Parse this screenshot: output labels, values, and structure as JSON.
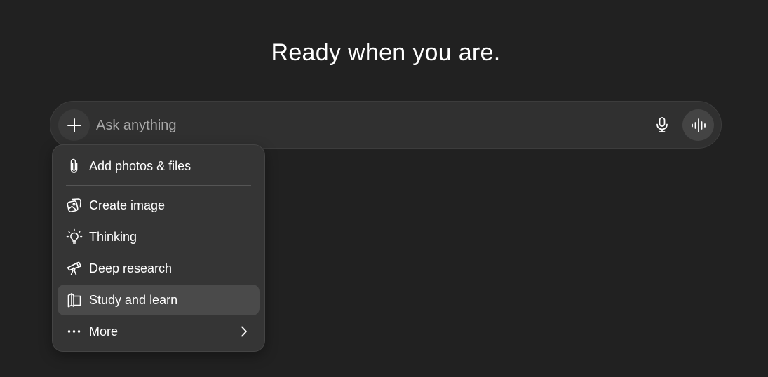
{
  "hero": {
    "title": "Ready when you are."
  },
  "composer": {
    "placeholder": "Ask anything",
    "value": "",
    "add_icon": "plus-icon",
    "mic_icon": "microphone-icon",
    "voice_icon": "voice-waveform-icon"
  },
  "menu": {
    "items": [
      {
        "label": "Add photos & files",
        "icon": "paperclip-icon"
      },
      {
        "label": "Create image",
        "icon": "image-icon"
      },
      {
        "label": "Thinking",
        "icon": "lightbulb-icon"
      },
      {
        "label": "Deep research",
        "icon": "telescope-icon"
      },
      {
        "label": "Study and learn",
        "icon": "book-icon",
        "highlighted": true
      },
      {
        "label": "More",
        "icon": "ellipsis-icon",
        "submenu": true
      }
    ]
  },
  "colors": {
    "background": "#212121",
    "composer": "#303030",
    "menu": "#353535",
    "menu_highlight": "#4a4a4a",
    "text": "#ffffff",
    "placeholder": "#a8a8a8"
  }
}
